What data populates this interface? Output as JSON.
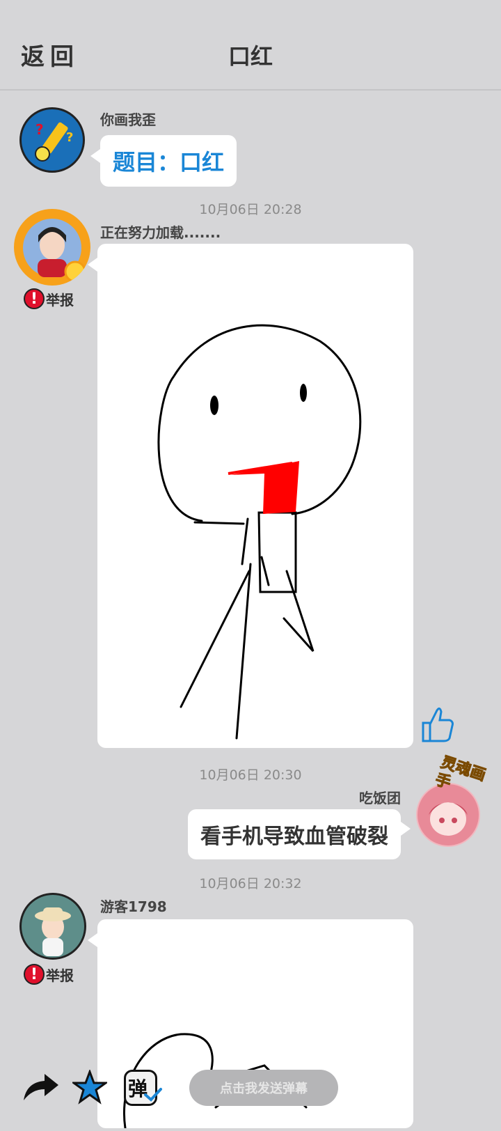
{
  "header": {
    "back_label": "返回",
    "title": "口红"
  },
  "messages": [
    {
      "sender": "你画我歪",
      "text": "题目：口红"
    },
    {
      "time": "10月06日  20:28",
      "sender": "正在努力加载.......",
      "report_label": "举报"
    },
    {
      "time": "10月06日  20:30",
      "sender": "吃饭团",
      "text": "看手机导致血管破裂",
      "badge": "灵魂画手"
    },
    {
      "time": "10月06日  20:32",
      "sender": "游客1798",
      "report_label": "举报"
    }
  ],
  "toolbar": {
    "danmu_placeholder": "点击我发送弹幕",
    "danmu_toggle_glyph": "弹"
  },
  "colors": {
    "background": "#d6d6d8",
    "accent": "#1a86d6",
    "report": "#e0102c",
    "lipstick": "#ff0000"
  }
}
